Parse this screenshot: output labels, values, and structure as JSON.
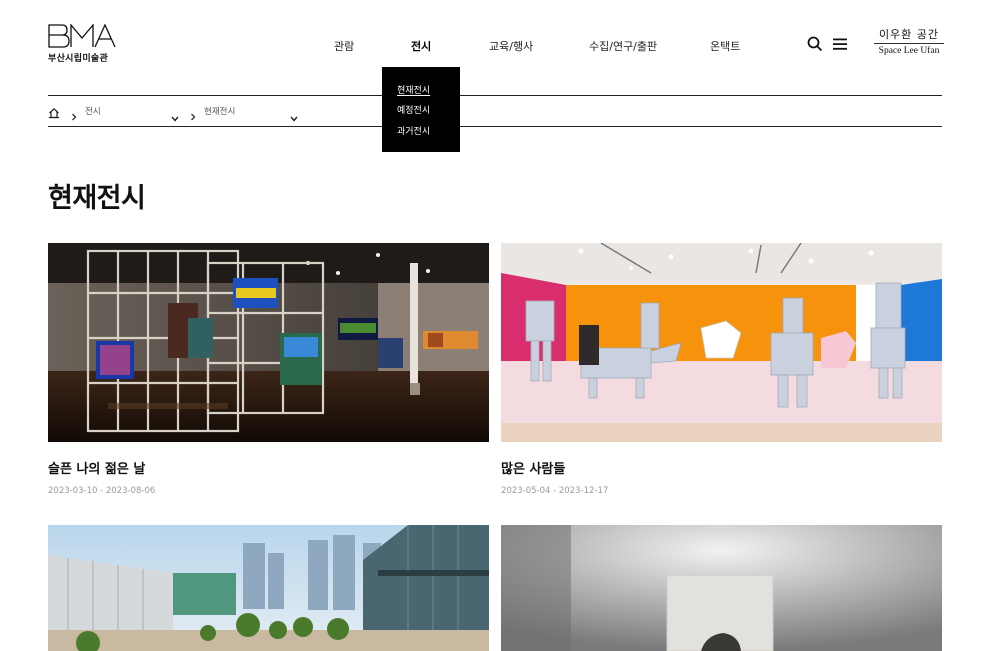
{
  "header": {
    "logo_text": "BMA",
    "logo_subtitle": "부산시립미술관",
    "nav": [
      {
        "label": "관람",
        "active": false
      },
      {
        "label": "전시",
        "active": true
      },
      {
        "label": "교육/행사",
        "active": false
      },
      {
        "label": "수집/연구/출판",
        "active": false
      },
      {
        "label": "온택트",
        "active": false
      }
    ],
    "icons": {
      "search": "search-icon",
      "menu": "menu-icon"
    },
    "space_link": {
      "korean": "이우환 공간",
      "english": "Space Lee Ufan"
    }
  },
  "dropdown": {
    "items": [
      {
        "label": "현재전시",
        "current": true
      },
      {
        "label": "예정전시",
        "current": false
      },
      {
        "label": "과거전시",
        "current": false
      }
    ]
  },
  "breadcrumb": {
    "home_icon": "home-icon",
    "level1": "전시",
    "level2": "현재전시"
  },
  "page": {
    "title": "현재전시"
  },
  "exhibitions": [
    {
      "title": "슬픈 나의 젊은 날",
      "date": "2023-03-10 - 2023-08-06"
    },
    {
      "title": "많은 사람들",
      "date": "2023-05-04 - 2023-12-17"
    },
    {
      "title": "",
      "date": ""
    },
    {
      "title": "",
      "date": ""
    }
  ],
  "colors": {
    "text": "#111111",
    "dropdown_bg": "#000000",
    "muted": "#999999"
  }
}
